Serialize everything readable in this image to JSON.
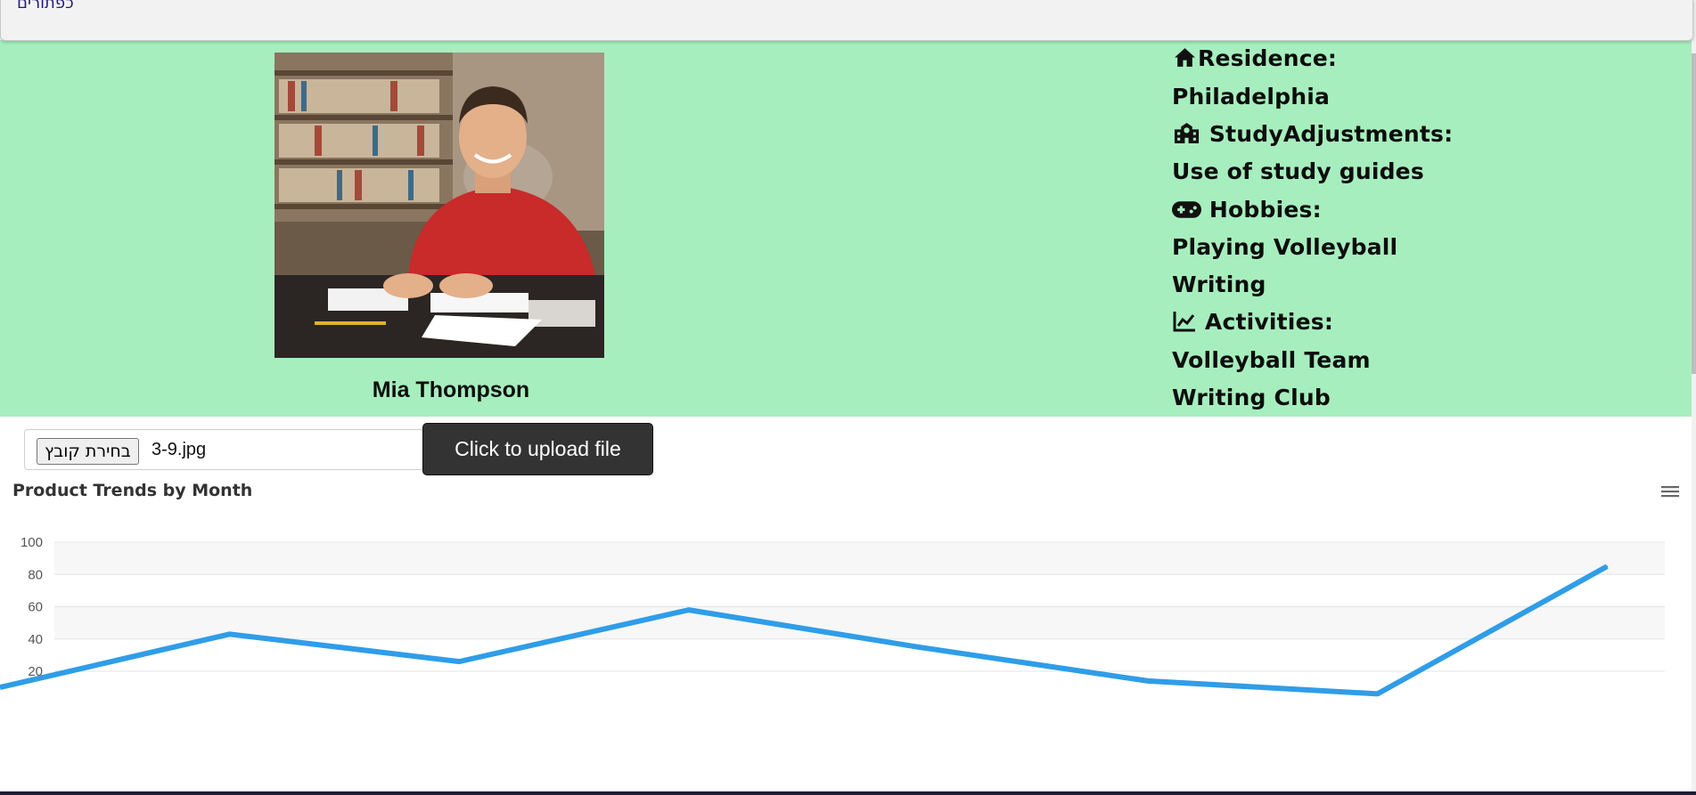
{
  "topbar": {
    "link_text": "כפתורים"
  },
  "profile": {
    "name": "Mia Thompson",
    "photo_alt": "student photo",
    "residence_label": "Residence:",
    "residence_value": "Philadelphia",
    "study_label": "StudyAdjustments:",
    "study_value": "Use of study guides",
    "hobbies_label": "Hobbies:",
    "hobbies": [
      "Playing Volleyball",
      "Writing"
    ],
    "activities_label": "Activities:",
    "activities": [
      "Volleyball Team",
      "Writing Club"
    ]
  },
  "upload": {
    "choose_label": "בחירת קובץ",
    "file_name": "3-9.jpg",
    "button_label": "Click to upload file"
  },
  "icons": {
    "residence": "home-icon",
    "study": "school-icon",
    "hobbies": "gamepad-icon",
    "activities": "line-chart-icon",
    "menu": "hamburger-menu-icon"
  },
  "colors": {
    "profile_bg": "#a7eebe",
    "series": "#2f9de8",
    "upload_btn": "#333333"
  },
  "chart_data": {
    "type": "line",
    "title": "Product Trends by Month",
    "xlabel": "",
    "ylabel": "",
    "ylim": [
      20,
      100
    ],
    "yticks": [
      100,
      80,
      60,
      40,
      20
    ],
    "grid": true,
    "legend": "none",
    "series": [
      {
        "values": [
          10,
          43,
          26,
          58,
          35,
          14,
          6,
          85
        ]
      }
    ]
  }
}
